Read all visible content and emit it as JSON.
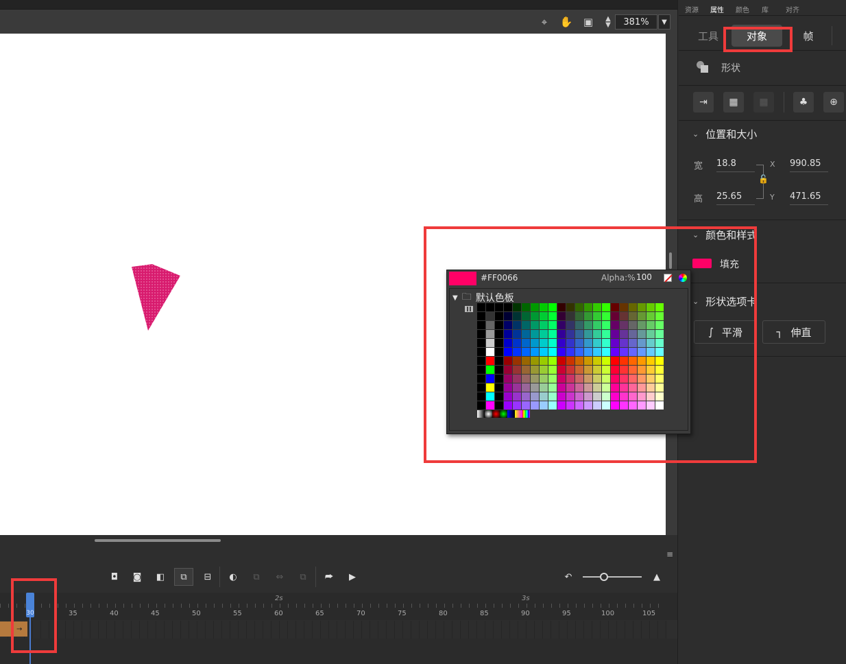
{
  "toolbar": {
    "zoom_value": "381%"
  },
  "panel_tabs": [
    "资源",
    "属性",
    "颜色",
    "库",
    "对齐"
  ],
  "panel_subtabs": {
    "tool": "工具",
    "object": "对象",
    "frame": "帧"
  },
  "object_type": "形状",
  "position_size": {
    "title": "位置和大小",
    "width_label": "宽",
    "width_value": "18.8",
    "height_label": "高",
    "height_value": "25.65",
    "x_label": "X",
    "x_value": "990.85",
    "y_label": "Y",
    "y_value": "471.65"
  },
  "color_style": {
    "title": "颜色和样式",
    "fill_label": "填充",
    "fill_color": "#FF0066"
  },
  "shape_options": {
    "title": "形状选项卡",
    "smooth_label": "平滑",
    "straighten_label": "伸直"
  },
  "color_popup": {
    "hex": "#FF0066",
    "alpha_label": "Alpha:%",
    "alpha_value": "100",
    "swatch_group": "默认色板"
  },
  "timeline": {
    "frame_labels": [
      "35",
      "40",
      "45",
      "50",
      "55",
      "60",
      "65",
      "70",
      "75",
      "80",
      "85",
      "90",
      "95",
      "100",
      "105"
    ],
    "second_labels": [
      "2s",
      "3s"
    ],
    "current_frame": "30"
  },
  "stage": {
    "shape_color": "#D81B6E"
  }
}
